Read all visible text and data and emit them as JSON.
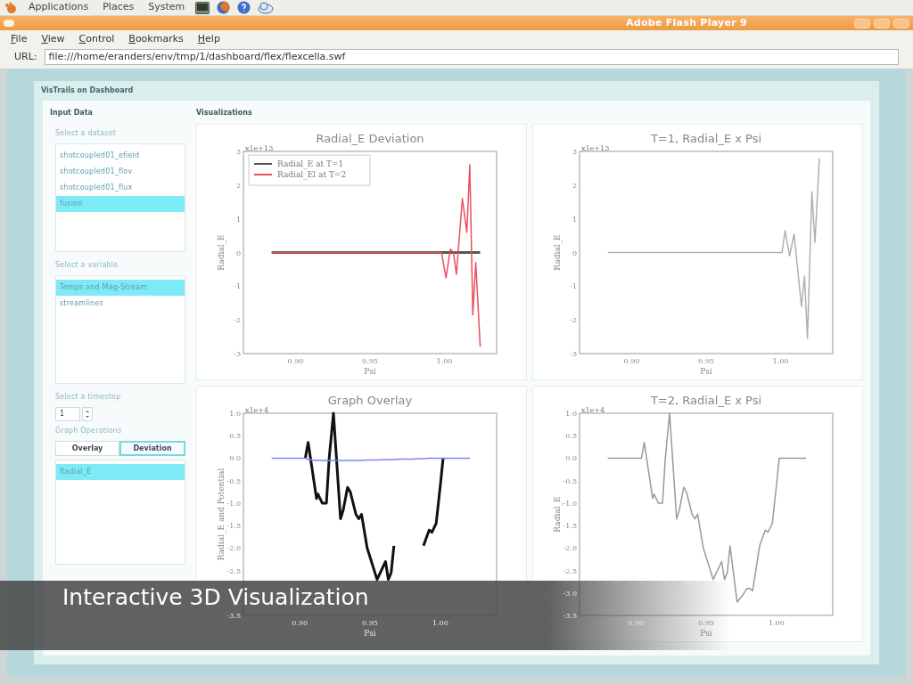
{
  "top_panel": {
    "menus": [
      "Applications",
      "Places",
      "System"
    ]
  },
  "window": {
    "title": "Adobe Flash Player 9"
  },
  "menu_bar": [
    "File",
    "View",
    "Control",
    "Bookmarks",
    "Help"
  ],
  "url_bar": {
    "label": "URL:",
    "value": "file:///home/eranders/env/tmp/1/dashboard/flex/flexcella.swf"
  },
  "app": {
    "title": "VisTrails on Dashboard"
  },
  "sidebar": {
    "title": "Input Data",
    "dataset": {
      "label": "Select a dataset",
      "items": [
        {
          "label": "shotcoupled01_efield",
          "selected": false
        },
        {
          "label": "shotcoupled01_flov",
          "selected": false
        },
        {
          "label": "shotcoupled01_flux",
          "selected": false
        },
        {
          "label": "fusion",
          "selected": true
        }
      ]
    },
    "variable": {
      "label": "Select a variable",
      "items": [
        {
          "label": "Temps and Mag-Stream",
          "selected": true
        },
        {
          "label": "streamlines",
          "selected": false
        }
      ]
    },
    "timestep": {
      "label": "Select a timestep",
      "value": "1"
    },
    "graph_operations": {
      "label": "Graph Operations",
      "buttons": [
        {
          "label": "Overlay",
          "selected": false
        },
        {
          "label": "Deviation",
          "selected": true
        }
      ],
      "items": [
        {
          "label": "Radial_E",
          "selected": true
        }
      ]
    }
  },
  "visualizations": {
    "title": "Visualizations",
    "charts": [
      {
        "chart_data": {
          "type": "line",
          "title": "Radial_E Deviation",
          "xlabel": "Psi",
          "ylabel": "Radial_E",
          "xlim": [
            0.865,
            1.035
          ],
          "ylim": [
            -3,
            3
          ],
          "xticks": [
            {
              "value": 0.9,
              "label": "0.90"
            },
            {
              "value": 0.95,
              "label": "0.95"
            },
            {
              "value": 1.0,
              "label": "1.00"
            }
          ],
          "yticks": [
            -3,
            -2,
            -1,
            0,
            1,
            2,
            3
          ],
          "annotations": [
            "x1e+13"
          ],
          "legend": "upper left",
          "x": [
            0.884,
            0.998,
            1.001,
            1.004,
            1.006,
            1.008,
            1.012,
            1.015,
            1.017,
            1.019,
            1.021,
            1.024
          ],
          "series": [
            {
              "name": "Radial_E at T=1",
              "color": "#555555",
              "values": [
                0,
                0,
                0,
                0,
                0,
                0,
                0,
                0,
                0,
                0,
                0,
                0
              ]
            },
            {
              "name": "Radial_El at T=2",
              "color": "#e8505f",
              "values": [
                0,
                0,
                -0.75,
                0.1,
                0,
                -0.65,
                1.6,
                0.6,
                2.6,
                -1.85,
                -0.3,
                -2.8
              ]
            }
          ]
        }
      },
      {
        "chart_data": {
          "type": "line",
          "title": "T=1, Radial_E x Psi",
          "xlabel": "Psi",
          "ylabel": "Radial_E",
          "xlim": [
            0.865,
            1.035
          ],
          "ylim": [
            -3,
            3
          ],
          "xticks": [
            {
              "value": 0.9,
              "label": "0.90"
            },
            {
              "value": 0.95,
              "label": "0.95"
            },
            {
              "value": 1.0,
              "label": "1.00"
            }
          ],
          "yticks": [
            -3,
            -2,
            -1,
            0,
            1,
            2,
            3
          ],
          "annotations": [
            "x1e+13"
          ],
          "x": [
            0.884,
            0.999,
            1.001,
            1.003,
            1.006,
            1.009,
            1.014,
            1.016,
            1.018,
            1.021,
            1.023,
            1.026
          ],
          "series": [
            {
              "color": "#b0b0b0",
              "values": [
                0,
                0,
                0,
                0.65,
                -0.1,
                0.55,
                -1.6,
                -0.7,
                -2.55,
                1.8,
                0.3,
                2.8
              ]
            }
          ]
        }
      },
      {
        "chart_data": {
          "type": "line",
          "title": "Graph Overlay",
          "xlabel": "Psi",
          "ylabel": "Radial_E and Potential",
          "xlim": [
            0.86,
            1.04
          ],
          "ylim": [
            -3.5,
            1.0
          ],
          "xticks": [
            {
              "value": 0.9,
              "label": "0.90"
            },
            {
              "value": 0.95,
              "label": "0.95"
            },
            {
              "value": 1.0,
              "label": "1.00"
            }
          ],
          "yticks": [
            {
              "value": 1.0,
              "label": "1.0"
            },
            {
              "value": 0.5,
              "label": "0.5"
            },
            {
              "value": 0,
              "label": "0.0"
            },
            {
              "value": -0.5,
              "label": "-0.5"
            },
            {
              "value": -1.0,
              "label": "-1.0"
            },
            {
              "value": -1.5,
              "label": "-1.5"
            },
            {
              "value": -2.0,
              "label": "-2.0"
            },
            {
              "value": -2.5,
              "label": "-2.5"
            },
            {
              "value": -3.5,
              "label": "-3.5"
            }
          ],
          "annotations": [
            "x1e+4"
          ],
          "x": [
            0.88,
            0.904,
            0.906,
            0.912,
            0.913,
            0.916,
            0.919,
            0.921,
            0.924,
            0.929,
            0.931,
            0.934,
            0.936,
            0.94,
            0.942,
            0.944,
            0.948,
            0.955,
            0.961,
            0.963,
            0.965,
            0.967,
            0.972,
            0.976,
            0.979,
            0.981,
            0.983,
            0.988,
            0.992,
            0.994,
            0.997,
            1.0,
            1.002,
            1.021
          ],
          "series": [
            {
              "color": "#111111",
              "values": [
                null,
                0,
                0.35,
                -0.9,
                -0.8,
                -1.0,
                -1.0,
                0,
                1.0,
                -1.35,
                -1.15,
                -0.65,
                -0.75,
                -1.25,
                -1.35,
                -1.25,
                -2.0,
                -2.7,
                -2.3,
                -2.7,
                -2.55,
                -1.95,
                null,
                null,
                null,
                null,
                null,
                -1.95,
                -1.6,
                -1.65,
                -1.45,
                -0.6,
                0,
                null
              ]
            },
            {
              "color": "#7a86ee",
              "values": [
                0,
                0,
                -0.03,
                -0.05,
                -0.05,
                -0.05,
                -0.05,
                -0.05,
                -0.05,
                -0.05,
                -0.05,
                -0.05,
                -0.05,
                -0.05,
                -0.05,
                -0.05,
                -0.04,
                -0.04,
                -0.03,
                -0.03,
                -0.03,
                -0.03,
                -0.02,
                -0.02,
                -0.02,
                -0.02,
                -0.01,
                -0.01,
                0,
                0,
                0,
                0,
                0,
                0
              ]
            }
          ]
        }
      },
      {
        "chart_data": {
          "type": "line",
          "title": "T=2, Radial_E x Psi",
          "xlabel": "Psi",
          "ylabel": "Radial_E",
          "xlim": [
            0.86,
            1.04
          ],
          "ylim": [
            -3.5,
            1.0
          ],
          "xticks": [
            {
              "value": 0.9,
              "label": "0.90"
            },
            {
              "value": 0.95,
              "label": "0.95"
            },
            {
              "value": 1.0,
              "label": "1.00"
            }
          ],
          "yticks": [
            {
              "value": 1.0,
              "label": "1.0"
            },
            {
              "value": 0.5,
              "label": "0.5"
            },
            {
              "value": 0,
              "label": "0.0"
            },
            {
              "value": -0.5,
              "label": "-0.5"
            },
            {
              "value": -1.0,
              "label": "-1.0"
            },
            {
              "value": -1.5,
              "label": "-1.5"
            },
            {
              "value": -2.0,
              "label": "-2.0"
            },
            {
              "value": -2.5,
              "label": "-2.5"
            },
            {
              "value": -3.0,
              "label": "-3.0"
            },
            {
              "value": -3.5,
              "label": "-3.5"
            }
          ],
          "annotations": [
            "x1e+4"
          ],
          "x": [
            0.88,
            0.904,
            0.906,
            0.912,
            0.913,
            0.916,
            0.919,
            0.921,
            0.924,
            0.929,
            0.931,
            0.934,
            0.936,
            0.94,
            0.942,
            0.944,
            0.948,
            0.955,
            0.961,
            0.963,
            0.965,
            0.967,
            0.972,
            0.976,
            0.979,
            0.981,
            0.983,
            0.988,
            0.992,
            0.994,
            0.997,
            1.0,
            1.002,
            1.021
          ],
          "series": [
            {
              "color": "#9a9a9a",
              "values": [
                0,
                0,
                0.35,
                -0.9,
                -0.8,
                -1.0,
                -1.0,
                0,
                1.0,
                -1.35,
                -1.15,
                -0.65,
                -0.75,
                -1.25,
                -1.35,
                -1.25,
                -2.0,
                -2.7,
                -2.3,
                -2.7,
                -2.55,
                -1.95,
                -3.2,
                -3.05,
                -2.9,
                -2.9,
                -2.95,
                -1.95,
                -1.6,
                -1.65,
                -1.45,
                -0.6,
                0,
                0
              ]
            }
          ]
        }
      }
    ]
  },
  "caption": "Interactive 3D Visualization"
}
